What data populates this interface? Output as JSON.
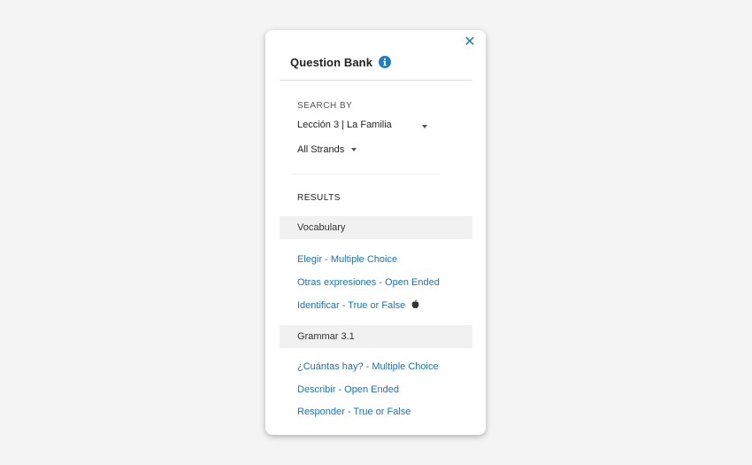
{
  "panel": {
    "title": "Question Bank",
    "close_icon": "close-icon",
    "info_icon": "info-icon"
  },
  "search": {
    "label": "SEARCH BY",
    "lesson_value": "Lección 3 | La Familia",
    "strands_value": "All Strands"
  },
  "results": {
    "label": "RESULTS",
    "groups": [
      {
        "name": "Vocabulary",
        "items": [
          {
            "label": "Elegir - Multiple Choice"
          },
          {
            "label": "Otras expresiones - Open Ended"
          },
          {
            "label": "Identificar - True or False",
            "icon": "apple-icon"
          }
        ]
      },
      {
        "name": "Grammar 3.1",
        "items": [
          {
            "label": "¿Cuántas hay? - Multiple Choice"
          },
          {
            "label": "Describir - Open Ended"
          },
          {
            "label": "Responder - True or False"
          }
        ]
      }
    ]
  },
  "colors": {
    "accent": "#1a73b5",
    "background": "#f4f4f4",
    "group_header_bg": "#f1f1f1"
  }
}
